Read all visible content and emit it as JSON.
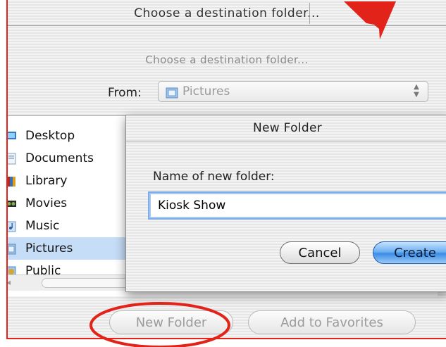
{
  "sheet": {
    "title": "Choose a destination folder...",
    "prompt": "Choose a destination folder...",
    "from_label": "From:",
    "from_value": "Pictures",
    "popup_arrows": "▲\n▼"
  },
  "browser": {
    "items": [
      {
        "label": "Desktop",
        "icon": "desktop-icon"
      },
      {
        "label": "Documents",
        "icon": "documents-folder-icon"
      },
      {
        "label": "Library",
        "icon": "library-folder-icon"
      },
      {
        "label": "Movies",
        "icon": "movies-folder-icon"
      },
      {
        "label": "Music",
        "icon": "music-folder-icon"
      },
      {
        "label": "Pictures",
        "icon": "pictures-folder-icon",
        "selected": true
      },
      {
        "label": "Public",
        "icon": "public-folder-icon"
      }
    ],
    "scroll_left_arrow": "◂"
  },
  "buttons": {
    "new_folder": "New Folder",
    "add_to_favorites": "Add to Favorites"
  },
  "new_folder_dialog": {
    "title": "New Folder",
    "name_label": "Name of new folder:",
    "name_value": "Kiosk Show",
    "cancel_label": "Cancel",
    "create_label": "Create"
  },
  "colors": {
    "annotation_red": "#e2231a",
    "selection_blue": "#c6ddf7",
    "default_button_blue": "#3b8ee6"
  }
}
